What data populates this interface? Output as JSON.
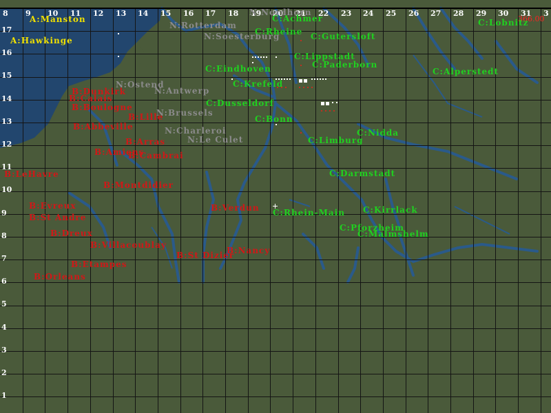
{
  "score": "366.00",
  "colors": {
    "land": "#4a5a3a",
    "water": "#22466e",
    "river": "#2a5a8a",
    "grid": "#141414",
    "allied": "#f0e000",
    "british": "#d01818",
    "neutral": "#8a8a8a",
    "german": "#20d020"
  },
  "grid": {
    "x_labels": [
      "8",
      "9",
      "10",
      "11",
      "12",
      "13",
      "14",
      "15",
      "16",
      "17",
      "18",
      "19",
      "20",
      "21",
      "22",
      "23",
      "24",
      "25",
      "26",
      "27",
      "28",
      "29",
      "30",
      "31",
      "3"
    ],
    "y_labels": [
      "17",
      "16",
      "15",
      "14",
      "13",
      "12",
      "11",
      "10",
      "9",
      "8",
      "7",
      "6",
      "5",
      "4",
      "3",
      "2",
      "1"
    ]
  },
  "bases": {
    "allied": [
      "A:Manston",
      "A:Hawkinge"
    ],
    "british": [
      "B:Dunkirk",
      "B:Calais",
      "B:Boulogne",
      "B:Lille",
      "B:Abbeville",
      "B:Arras",
      "B:Cambrai",
      "B:Amiens",
      "B:LeHavre",
      "B:Montdidier",
      "B:Evreux",
      "B:St Andre",
      "B:Dreux",
      "B:Villacoublay",
      "B:Etampes",
      "B:Orleans",
      "B:Verdun",
      "B:Nancy",
      "B:St Dizier"
    ],
    "neutral": [
      "N:Nordhorn",
      "N:Rotterdam",
      "N:Soesterburg",
      "N:Ostend",
      "N:Antwerp",
      "N:Brussels",
      "N:Charleroi",
      "N:Le Culet"
    ],
    "german": [
      "C:Achmer",
      "C:Lobnitz",
      "C:Rheine",
      "C:Gutersloft",
      "C:Lippstadt",
      "C:Paderborn",
      "C:Eindhoven",
      "C:Alperstedt",
      "C:Krefeld",
      "C:Dusseldorf",
      "C:Bonn",
      "C:Nidda",
      "C:Limburg",
      "C:Darmstadt",
      "C:Rhein-Main",
      "C:Kirrlack",
      "C:Pforzheim",
      "C:Malmshelm"
    ]
  }
}
